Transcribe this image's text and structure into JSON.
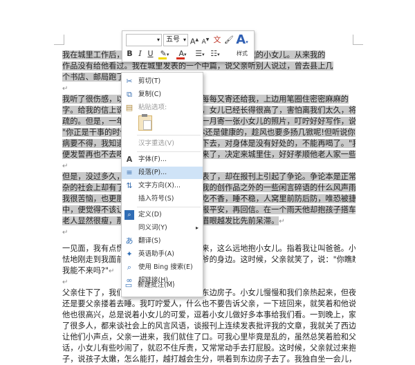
{
  "paragraphs": [
    {
      "lines": [
        "我在城里工作后，父亲就一个人住在村子里，他照管着我的小女儿。从来我的",
        "作品没有给他看过。我在城里发表的一个中篇，说父亲听别人说过，曾去县上几",
        "个书店、邮局跑了，想买些回去读读。"
      ]
    },
    {
      "lines": [
        "我听了很伤感，以为父亲是要表扬我。他每每又寄还给我，上边用笔圈住密密麻麻的",
        "字。给我的信上说，我的文章他已经读了，女儿已经长得很高了，害怕离我们太久，将来会生",
        "疏的。但是，一年过去了，他又来了信，一月寄一张小女儿的照片，叮咛好好写作，说：",
        "\"你正是干事的时候，不要顾家，我的身体还是健康的，趁风也要多扬几锨呢!但听说你喝酒厉害，这毛",
        "病要不得，我知道你烦的事多，可这么喝下去，对身体是没有好处的，不能再喝了。\"我读到他，我十分羞愧，",
        "便发誓再也不去喝酒了。那年冬天，父亲来了，决定来城里住，好好孝顺他老人家一些日子。"
      ]
    },
    {
      "lines": [
        "但是，没过多久，我的作品在一些报刊发表了，却在报刊上引起了争论。争论本是正常的事，复",
        "杂的社会上却有了流言飞语，甚至说到了我的创作品之外的一些闲言碎语的什么风声雨声都有。",
        "我很苦恼，也更胆小，我得了病，多少天吃不香，睡不稳，人窝里前防后防，唯恐被捷翻了担子。茫然",
        "中，便觉得不该让父亲知道这些，来信只报平安，再回信。在一个雨天他却抱孩子搭车来了。"
      ]
    },
    {
      "lines": [
        "老人显然很瘦，那一头白发，面皮松弛，眉眼越发比先前呆滞。"
      ]
    },
    {
      "lines": [
        "一见面，我有点慌，埋怨父亲不该这么远来，这么远地抱小女儿。指着我让叫爸爸。小女儿斜着看我，怯",
        "怯地刚走到我面前，就又哭着跑回了她爷爷的身边。这时候，父亲就笑了，说：\"你瞧瞧，她真生疏了，",
        "我能不来吗?\""
      ]
    },
    {
      "lines": [
        "父亲住下了，我们睡在西边房子，他睡在东边房子。小女儿慢慢和我们亲热起来，但夜里却",
        "还是要父亲搂着去睡。我叮咛爱人，什么也不要告诉父亲，一下班回来，就笑着和他说话。",
        "他也很高兴，总是说着小女儿的可爱，逗着小女儿做好多本事给我们看。一到晚上，家里来",
        "了很多人，都来谈社会上的风言风语，谈报刊上连续发表批评我的文章，我就关了西边门，",
        "让他们小声点，父亲一进来，我们就住了口。可我心里毕竟是乱的，虽然总笑着脸和父亲说",
        "话，小女儿有些吵闹了，就忍不住斥责，又常常动手去打屁股。这时候，父亲就过来抱了孩",
        "子，说孩子太嫩，怎么能打，越打越会生分，哄着到东边房子去了。我独自坐一会儿，觉得"
      ]
    }
  ],
  "mini_toolbar": {
    "font_name": "",
    "font_size": "五号",
    "grow_font": "A",
    "shrink_font": "A",
    "bold": "B",
    "italic": "I",
    "underline": "U",
    "font_color_letter": "A",
    "styles_letter": "A",
    "styles_label": "样式",
    "highlight_color": "#f2d900",
    "font_color": "#d62c1a"
  },
  "context_menu": {
    "items": [
      {
        "label": "剪切(T)",
        "icon": "scissors-icon",
        "glyph": "✂",
        "state": "normal"
      },
      {
        "label": "复制(C)",
        "icon": "copy-icon",
        "glyph": "⧉",
        "state": "normal"
      },
      {
        "label": "粘贴选项:",
        "icon": "paste-icon",
        "glyph": "📋",
        "state": "disabled"
      },
      {
        "label": "汉字重选(V)",
        "icon": "",
        "glyph": "",
        "state": "disabled"
      },
      {
        "label": "字体(F)...",
        "icon": "font-icon",
        "glyph": "A",
        "state": "normal"
      },
      {
        "label": "段落(P)...",
        "icon": "paragraph-icon",
        "glyph": "≡",
        "state": "highlighted"
      },
      {
        "label": "文字方向(X)...",
        "icon": "text-direction-icon",
        "glyph": "⇅",
        "state": "normal"
      },
      {
        "label": "插入符号(S)",
        "icon": "",
        "glyph": "",
        "state": "normal"
      },
      {
        "label": "定义(D)",
        "icon": "define-icon",
        "glyph": "🔍",
        "state": "normal"
      },
      {
        "label": "同义词(Y)",
        "icon": "",
        "glyph": "",
        "state": "normal",
        "submenu": "▸"
      },
      {
        "label": "翻译(S)",
        "icon": "translate-icon",
        "glyph": "あ",
        "state": "normal"
      },
      {
        "label": "英语助手(A)",
        "icon": "english-assistant-icon",
        "glyph": "✦",
        "state": "normal"
      },
      {
        "label": "使用 Bing 搜索(E)",
        "icon": "bing-search-icon",
        "glyph": "⌕",
        "state": "normal"
      },
      {
        "label": "超链接(H)...",
        "icon": "hyperlink-icon",
        "glyph": "🔗",
        "state": "normal"
      },
      {
        "label": "新建批注(M)",
        "icon": "new-comment-icon",
        "glyph": "▭",
        "state": "normal"
      }
    ],
    "paste_option_icon": "clipboard-icon",
    "highlight_color": "#cfe3f7"
  },
  "paragraph_mark": "↵"
}
